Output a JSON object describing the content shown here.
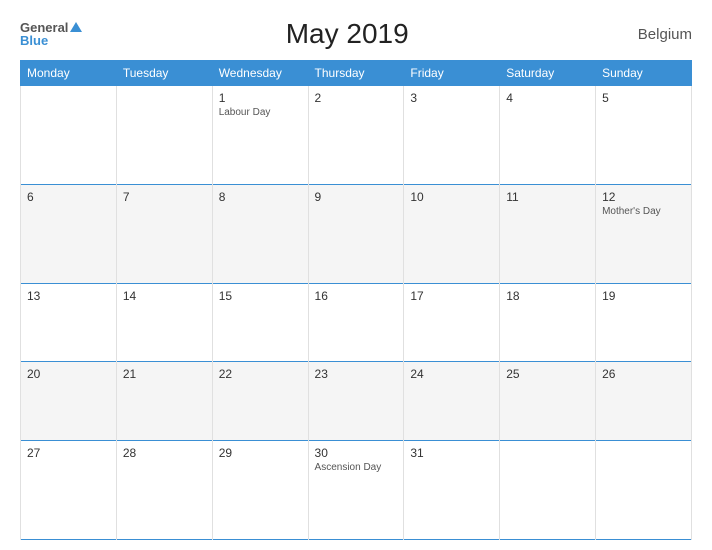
{
  "header": {
    "logo_general": "General",
    "logo_blue": "Blue",
    "title": "May 2019",
    "country": "Belgium"
  },
  "calendar": {
    "days_of_week": [
      "Monday",
      "Tuesday",
      "Wednesday",
      "Thursday",
      "Friday",
      "Saturday",
      "Sunday"
    ],
    "weeks": [
      [
        {
          "day": "",
          "holiday": ""
        },
        {
          "day": "",
          "holiday": ""
        },
        {
          "day": "1",
          "holiday": "Labour Day"
        },
        {
          "day": "2",
          "holiday": ""
        },
        {
          "day": "3",
          "holiday": ""
        },
        {
          "day": "4",
          "holiday": ""
        },
        {
          "day": "5",
          "holiday": ""
        }
      ],
      [
        {
          "day": "6",
          "holiday": ""
        },
        {
          "day": "7",
          "holiday": ""
        },
        {
          "day": "8",
          "holiday": ""
        },
        {
          "day": "9",
          "holiday": ""
        },
        {
          "day": "10",
          "holiday": ""
        },
        {
          "day": "11",
          "holiday": ""
        },
        {
          "day": "12",
          "holiday": "Mother's Day"
        }
      ],
      [
        {
          "day": "13",
          "holiday": ""
        },
        {
          "day": "14",
          "holiday": ""
        },
        {
          "day": "15",
          "holiday": ""
        },
        {
          "day": "16",
          "holiday": ""
        },
        {
          "day": "17",
          "holiday": ""
        },
        {
          "day": "18",
          "holiday": ""
        },
        {
          "day": "19",
          "holiday": ""
        }
      ],
      [
        {
          "day": "20",
          "holiday": ""
        },
        {
          "day": "21",
          "holiday": ""
        },
        {
          "day": "22",
          "holiday": ""
        },
        {
          "day": "23",
          "holiday": ""
        },
        {
          "day": "24",
          "holiday": ""
        },
        {
          "day": "25",
          "holiday": ""
        },
        {
          "day": "26",
          "holiday": ""
        }
      ],
      [
        {
          "day": "27",
          "holiday": ""
        },
        {
          "day": "28",
          "holiday": ""
        },
        {
          "day": "29",
          "holiday": ""
        },
        {
          "day": "30",
          "holiday": "Ascension Day"
        },
        {
          "day": "31",
          "holiday": ""
        },
        {
          "day": "",
          "holiday": ""
        },
        {
          "day": "",
          "holiday": ""
        }
      ]
    ]
  }
}
